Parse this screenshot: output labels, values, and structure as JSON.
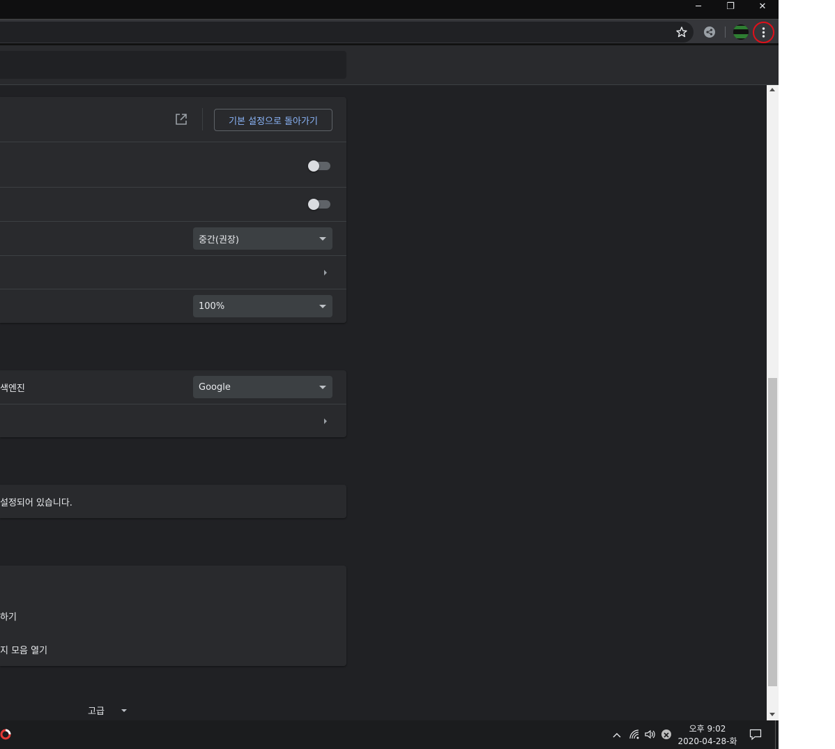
{
  "window": {
    "minimize_glyph": "─",
    "restore_glyph": "❐",
    "close_glyph": "✕"
  },
  "toolbar": {
    "bookmark_icon": "star-icon",
    "menu_icon": "three-dot-menu-icon",
    "highlight_color": "#e0101a"
  },
  "appearance": {
    "reset_button": "기본 설정으로 돌아가기",
    "font_size_value": "중간(권장)",
    "zoom_value": "100%"
  },
  "search_engine": {
    "engine_label": "색엔진",
    "engine_value": "Google"
  },
  "default_browser": {
    "status_text": "설정되어 있습니다."
  },
  "on_startup": {
    "option_2": "하기",
    "option_3": "지 모음 열기"
  },
  "advanced": {
    "label": "고급"
  },
  "taskbar": {
    "time": "오후 9:02",
    "date": "2020-04-28-화"
  },
  "colors": {
    "background": "#202124",
    "card": "#292a2d",
    "accent": "#8ab4f8"
  }
}
